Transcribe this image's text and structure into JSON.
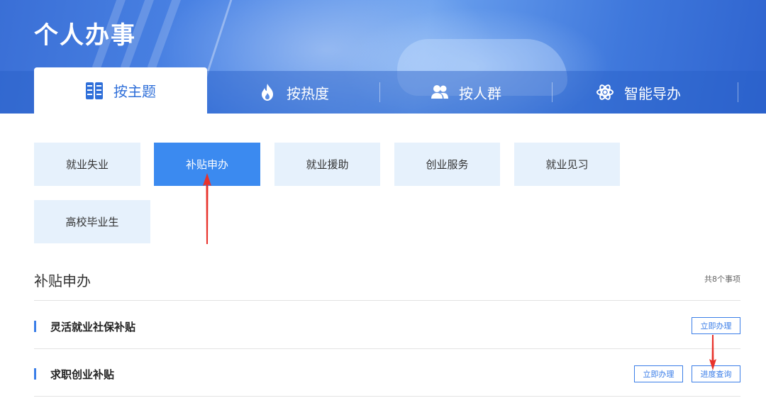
{
  "header": {
    "title": "个人办事"
  },
  "tabs": [
    {
      "label": "按主题",
      "icon": "theme-grid-icon",
      "active": true
    },
    {
      "label": "按热度",
      "icon": "flame-icon",
      "active": false
    },
    {
      "label": "按人群",
      "icon": "users-icon",
      "active": false
    },
    {
      "label": "智能导办",
      "icon": "atom-icon",
      "active": false
    }
  ],
  "categories": [
    {
      "label": "就业失业",
      "active": false
    },
    {
      "label": "补贴申办",
      "active": true
    },
    {
      "label": "就业援助",
      "active": false
    },
    {
      "label": "创业服务",
      "active": false
    },
    {
      "label": "就业见习",
      "active": false
    },
    {
      "label": "高校毕业生",
      "active": false
    }
  ],
  "section": {
    "title": "补贴申办",
    "count": "共8个事项"
  },
  "items": [
    {
      "name": "灵活就业社保补贴",
      "buttons": [
        "立即办理"
      ]
    },
    {
      "name": "求职创业补贴",
      "buttons": [
        "立即办理",
        "进度查询"
      ]
    }
  ],
  "colors": {
    "accent": "#3b8af0",
    "category_bg": "#e6f1fc",
    "annotation_arrow": "#e8332c"
  }
}
